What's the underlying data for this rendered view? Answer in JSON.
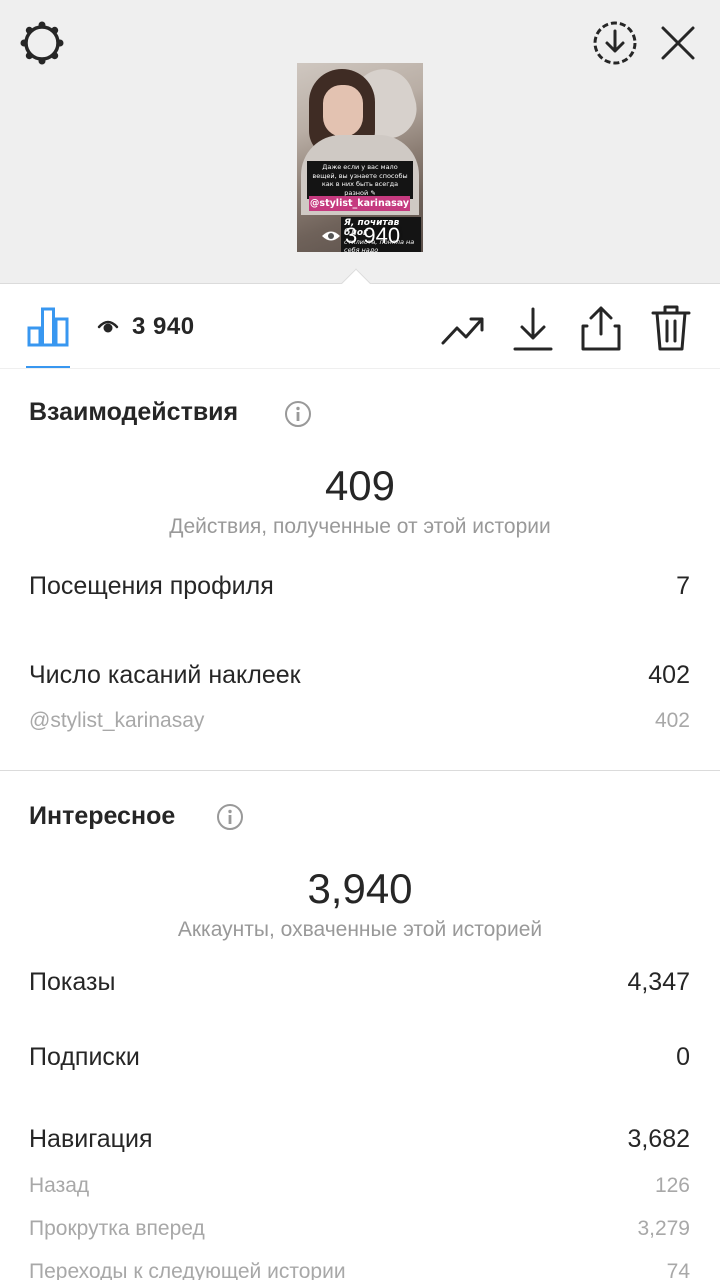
{
  "story_preview": {
    "caption_text": "Даже если у вас мало вещей, вы узнаете способы как в них быть всегда разной ✎",
    "mention_sticker": "@stylist_karinasay",
    "tag_title": "Я, почитав блог",
    "tag_text": "стилиста, поняла на себя надо совершенно с другой",
    "views_overlay": "3 940"
  },
  "toolbar": {
    "view_count": "3 940"
  },
  "interactions": {
    "title": "Взаимодействия",
    "total": "409",
    "total_caption": "Действия, полученные от этой истории",
    "profile_visits_label": "Посещения профиля",
    "profile_visits_value": "7",
    "sticker_taps_label": "Число касаний наклеек",
    "sticker_taps_value": "402",
    "sticker_name": "@stylist_karinasay",
    "sticker_value": "402"
  },
  "discovery": {
    "title": "Интересное",
    "reach": "3,940",
    "reach_caption": "Аккаунты, охваченные этой историей",
    "impressions_label": "Показы",
    "impressions_value": "4,347",
    "follows_label": "Подписки",
    "follows_value": "0",
    "navigation_label": "Навигация",
    "navigation_value": "3,682",
    "back_label": "Назад",
    "back_value": "126",
    "forward_label": "Прокрутка вперед",
    "forward_value": "3,279",
    "next_story_label": "Переходы к следующей истории",
    "next_story_value": "74"
  },
  "colors": {
    "accent_blue": "#3897f0",
    "mention_sticker_bg": "#c53a7f",
    "secondary_text": "#999999"
  },
  "icons": [
    "settings-icon",
    "download-circle-icon",
    "close-icon",
    "insights-bar-icon",
    "eye-icon",
    "trending-icon",
    "download-icon",
    "share-icon",
    "trash-icon",
    "info-icon"
  ]
}
